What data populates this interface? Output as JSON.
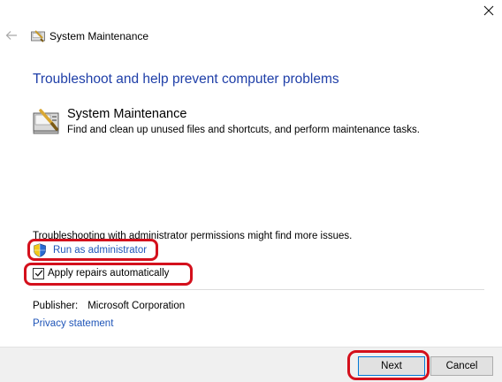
{
  "window": {
    "title": "System Maintenance",
    "back_icon": "back-arrow-icon",
    "close_icon": "close-icon"
  },
  "main": {
    "heading": "Troubleshoot and help prevent computer problems",
    "troubleshooter": {
      "icon": "system-maintenance-icon",
      "name": "System Maintenance",
      "description": "Find and clean up unused files and shortcuts, and perform maintenance tasks."
    },
    "permission_note": "Troubleshooting with administrator permissions might find more issues.",
    "run_as_admin": {
      "icon": "uac-shield-icon",
      "label": "Run as administrator"
    },
    "apply_repairs": {
      "label": "Apply repairs automatically",
      "checked": true
    },
    "publisher": {
      "label": "Publisher:",
      "value": "Microsoft Corporation"
    },
    "privacy_link": "Privacy statement"
  },
  "footer": {
    "next_label": "Next",
    "cancel_label": "Cancel"
  },
  "colors": {
    "heading": "#1f3fa8",
    "link": "#1f55b8",
    "annotation": "#d4101c",
    "footer_bg": "#f0f0f0"
  }
}
